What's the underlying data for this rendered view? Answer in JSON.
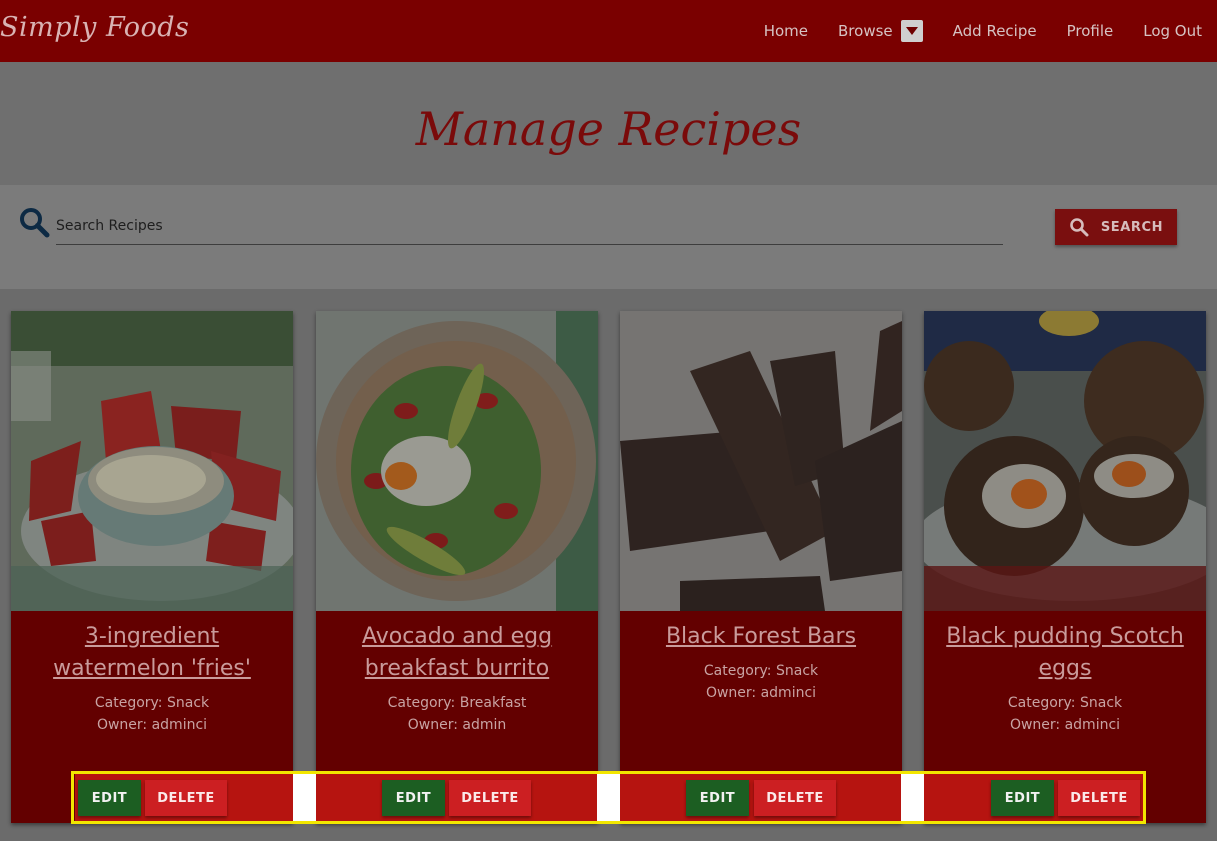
{
  "brand": "Simply Foods",
  "nav": {
    "items": [
      "Home",
      "Browse",
      "Add Recipe",
      "Profile",
      "Log Out"
    ]
  },
  "page": {
    "title": "Manage Recipes"
  },
  "search": {
    "placeholder": "Search Recipes",
    "button_label": "SEARCH"
  },
  "recipes": [
    {
      "title": "3-ingredient watermelon 'fries'",
      "category": "Category: Snack",
      "owner": "Owner: adminci",
      "image": "watermelon-fries-photo"
    },
    {
      "title": "Avocado and egg breakfast burrito",
      "category": "Category: Breakfast",
      "owner": "Owner: admin",
      "image": "burrito-photo"
    },
    {
      "title": "Black Forest Bars",
      "category": "Category: Snack",
      "owner": "Owner: adminci",
      "image": "chocolate-bars-photo"
    },
    {
      "title": "Black pudding Scotch eggs",
      "category": "Category: Snack",
      "owner": "Owner: adminci",
      "image": "scotch-eggs-photo"
    }
  ],
  "actions": {
    "edit_label": "EDIT",
    "delete_label": "DELETE"
  },
  "colors": {
    "navbar": "#7a0000",
    "card": "#630000",
    "action_bar": "#b61410",
    "edit": "#1c5e22",
    "delete": "#cc1f22",
    "highlight": "#f2e600"
  }
}
